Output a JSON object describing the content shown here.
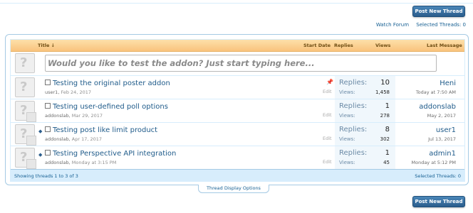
{
  "buttons": {
    "post_new_thread": "Post New Thread"
  },
  "toolbar": {
    "watch_forum": "Watch Forum",
    "selected_threads": "Selected Threads: 0"
  },
  "table_headers": {
    "title": "Title ↓",
    "start_date": "Start Date",
    "replies": "Replies",
    "views": "Views",
    "last_message": "Last Message"
  },
  "quick_thread": {
    "placeholder": "Would you like to test the addon? Just start typing here..."
  },
  "threads": [
    {
      "title": "Testing the original poster addon",
      "author": "user1",
      "date": "Feb 24, 2017",
      "replies_label": "Replies:",
      "replies": "10",
      "views_label": "Views:",
      "views": "1,458",
      "last_user": "Heni",
      "last_date": "Today at 7:50 AM",
      "edit": "Edit",
      "sticky": true,
      "unread": false
    },
    {
      "title": "Testing user-defined poll options",
      "author": "addonslab",
      "date": "Mar 29, 2017",
      "replies_label": "Replies:",
      "replies": "1",
      "views_label": "Views:",
      "views": "278",
      "last_user": "addonslab",
      "last_date": "May 2, 2017",
      "edit": "Edit",
      "sticky": false,
      "unread": false
    },
    {
      "title": "Testing post like limit product",
      "author": "addonslab",
      "date": "Apr 17, 2017",
      "replies_label": "Replies:",
      "replies": "8",
      "views_label": "Views:",
      "views": "302",
      "last_user": "user1",
      "last_date": "Jul 13, 2017",
      "edit": "Edit",
      "sticky": false,
      "unread": true
    },
    {
      "title": "Testing Perspective API integration",
      "author": "addonslab",
      "date": "Monday at 3:15 PM",
      "replies_label": "Replies:",
      "replies": "1",
      "views_label": "Views:",
      "views": "45",
      "last_user": "admin1",
      "last_date": "Monday at 5:12 PM",
      "edit": "Edit",
      "sticky": false,
      "unread": true
    }
  ],
  "footer": {
    "showing": "Showing threads 1 to 3 of 3",
    "selected": "Selected Threads: 0"
  },
  "thread_display_options": "Thread Display Options",
  "icons": {
    "avatar": "question-mark-avatar-icon",
    "sticky": "pin-icon",
    "unread": "unread-dot-icon"
  }
}
